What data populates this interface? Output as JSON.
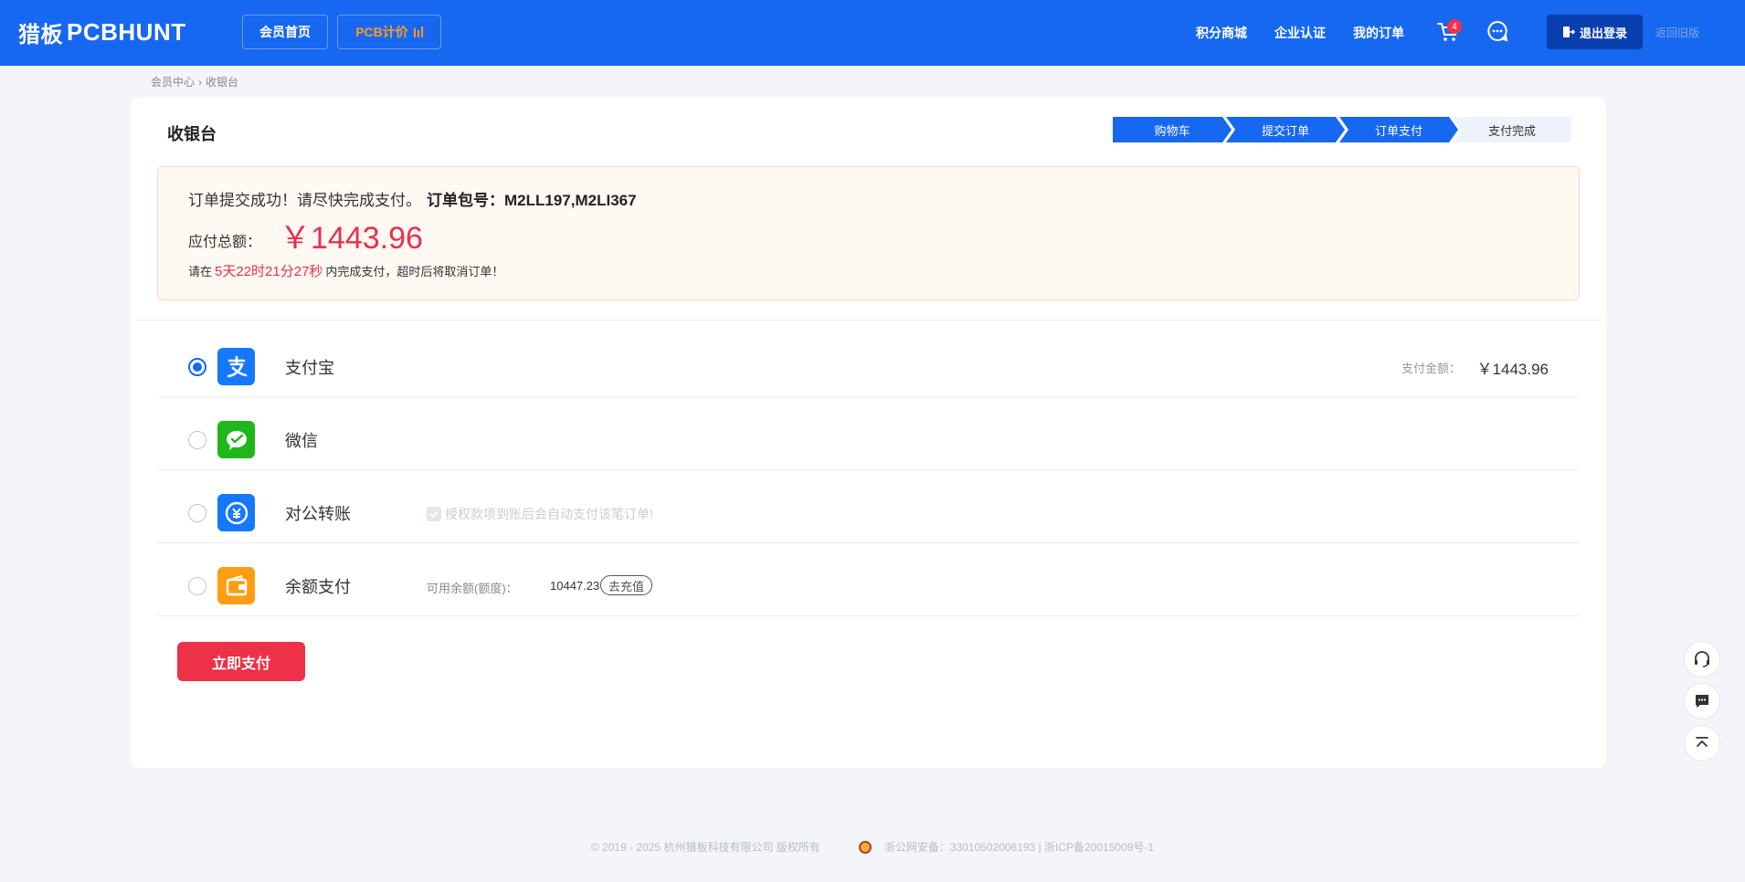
{
  "header": {
    "logo_cn": "猎板",
    "logo_en": "PCBHUNT",
    "nav_home": "会员首页",
    "nav_pcb": "PCB计价",
    "link_points": "积分商城",
    "link_enterprise": "企业认证",
    "link_orders": "我的订单",
    "cart_count": "4",
    "logout": "退出登录",
    "old_version": "返回旧版"
  },
  "breadcrumb": {
    "home": "会员中心",
    "sep": "›",
    "current": "收银台"
  },
  "page": {
    "title": "收银台"
  },
  "steps": [
    "购物车",
    "提交订单",
    "订单支付",
    "支付完成"
  ],
  "notice": {
    "message": "订单提交成功！请尽快完成支付。",
    "order_label": "订单包号：M2LL197,M2LI367",
    "total_label": "应付总额：",
    "total_value": "￥1443.96",
    "countdown_prefix": "请在",
    "countdown": "5天22时21分27秒",
    "countdown_suffix": "内完成支付，超时后将取消订单！"
  },
  "payment": {
    "alipay": {
      "name": "支付宝",
      "amount_label": "支付金额：",
      "amount": "￥1443.96"
    },
    "wechat": {
      "name": "微信"
    },
    "transfer": {
      "name": "对公转账",
      "note": "授权款项到账后会自动支付该笔订单!"
    },
    "balance": {
      "name": "余额支付",
      "label": "可用余额(额度)：",
      "value": "10447.23",
      "recharge": "去充值"
    }
  },
  "pay_now": "立即支付",
  "footer": {
    "copyright": "© 2019 - 2025 杭州猎板科技有限公司 版权所有",
    "record": "浙公网安备：33010502006193 | 浙ICP备20015009号-1"
  },
  "colors": {
    "brand": "#1768f0",
    "accent": "#ee3048",
    "orange": "#ff9a1f"
  }
}
